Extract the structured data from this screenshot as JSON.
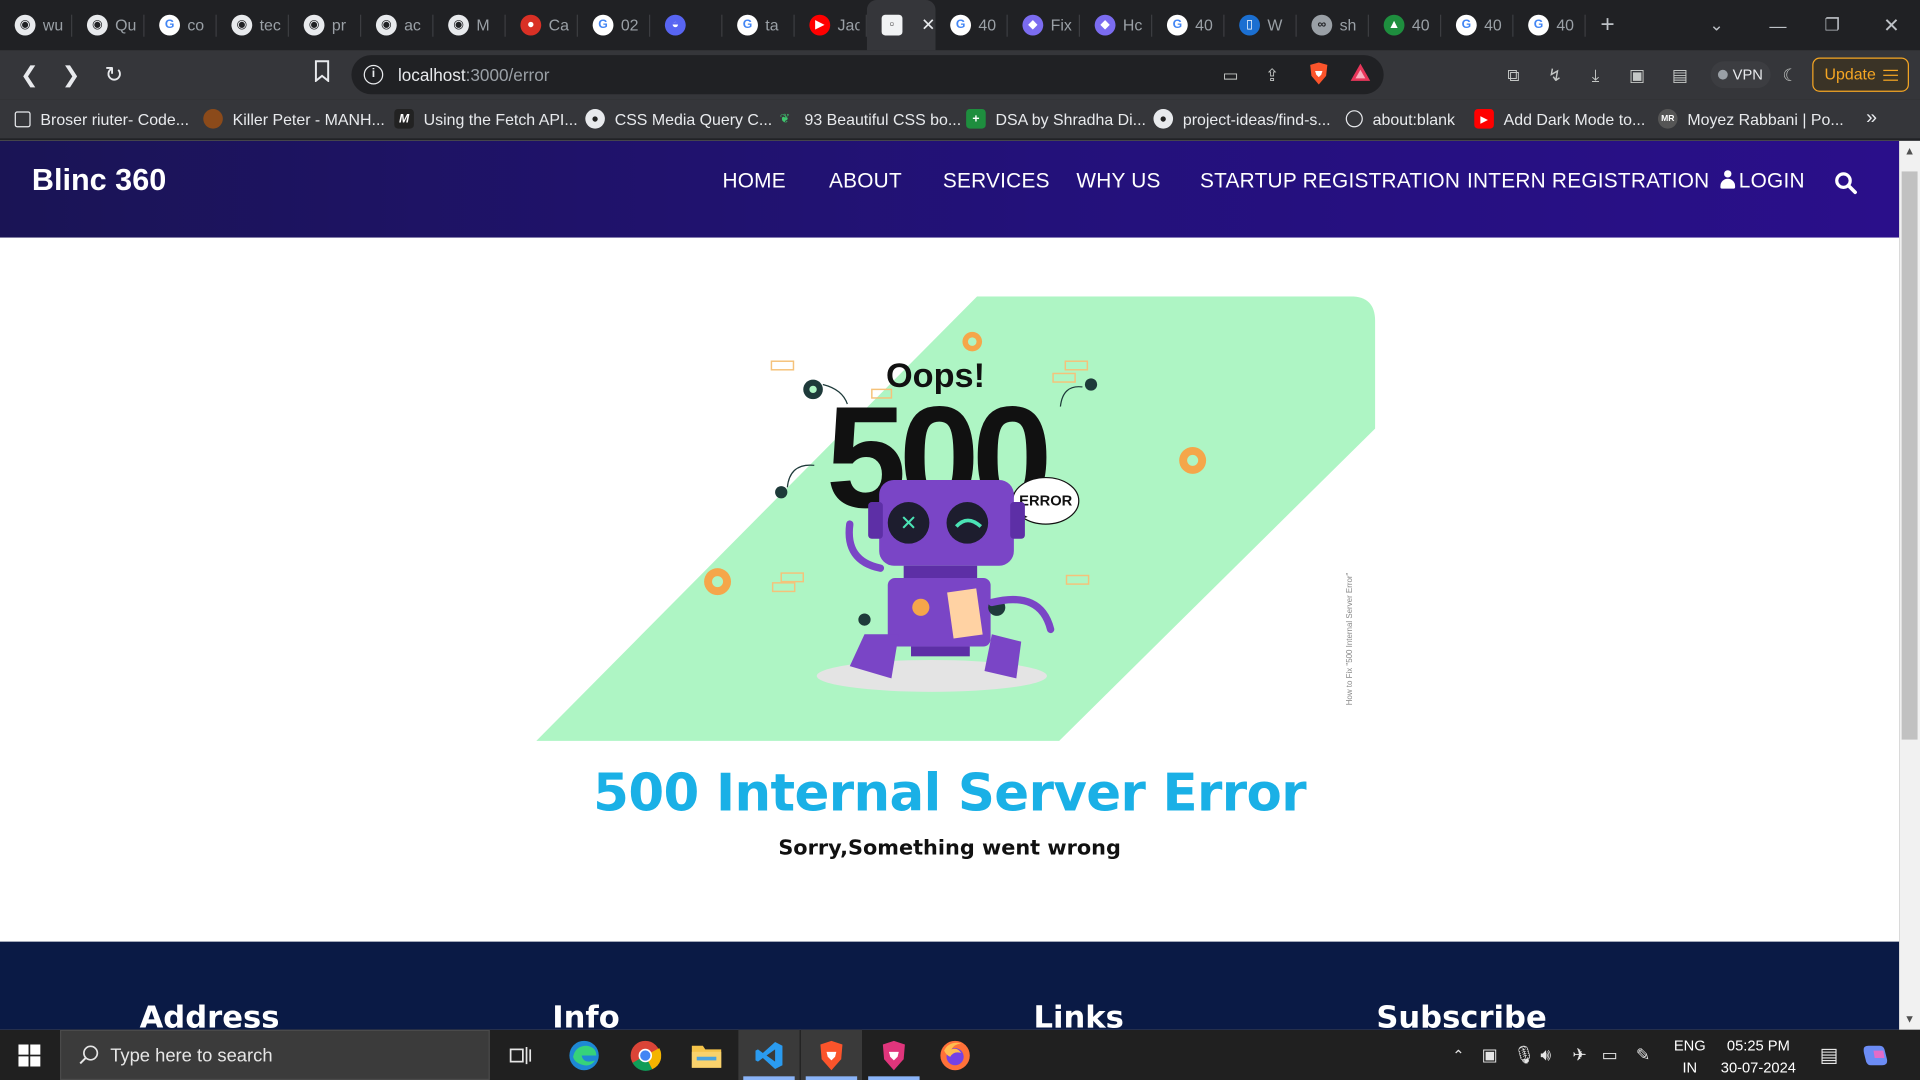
{
  "browser": {
    "tabs": [
      {
        "title": "wu",
        "icon": "github-icon"
      },
      {
        "title": "Qu",
        "icon": "github-icon"
      },
      {
        "title": "co",
        "icon": "google-icon"
      },
      {
        "title": "tec",
        "icon": "github-icon"
      },
      {
        "title": "pr",
        "icon": "github-icon"
      },
      {
        "title": "ac",
        "icon": "github-icon"
      },
      {
        "title": "M",
        "icon": "github-icon"
      },
      {
        "title": "Ca",
        "icon": "record-icon"
      },
      {
        "title": "02",
        "icon": "google-icon"
      },
      {
        "title": "",
        "icon": "discord-icon"
      },
      {
        "title": "ta",
        "icon": "google-icon"
      },
      {
        "title": "Jac",
        "icon": "youtube-icon"
      },
      {
        "title": "",
        "icon": "localhost-icon",
        "active": true
      },
      {
        "title": "40",
        "icon": "google-icon"
      },
      {
        "title": "Fix",
        "icon": "gitlab-icon"
      },
      {
        "title": "Hc",
        "icon": "gitlab-icon"
      },
      {
        "title": "40",
        "icon": "google-icon"
      },
      {
        "title": "W",
        "icon": "trello-icon"
      },
      {
        "title": "sh",
        "icon": "link-icon"
      },
      {
        "title": "40",
        "icon": "drive-icon"
      },
      {
        "title": "40",
        "icon": "google-icon"
      },
      {
        "title": "40",
        "icon": "google-icon"
      }
    ],
    "url_host": "localhost",
    "url_path": ":3000/error",
    "vpn_label": "VPN",
    "update_label": "Update",
    "bookmarks": [
      "Broser riuter- Code...",
      "Killer Peter - MANH...",
      "Using the Fetch API...",
      "CSS Media Query C...",
      "93 Beautiful CSS bo...",
      "DSA by Shradha Di...",
      "project-ideas/find-s...",
      "about:blank",
      "Add Dark Mode to...",
      "Moyez Rabbani | Po..."
    ],
    "bookmarks_more": "»"
  },
  "site": {
    "brand": "Blinc 360",
    "nav": [
      "HOME",
      "ABOUT",
      "SERVICES",
      "WHY US",
      "STARTUP REGISTRATION",
      "INTERN REGISTRATION"
    ],
    "login_label": "LOGIN",
    "illustration": {
      "oops": "Oops!",
      "code": "500",
      "bubble": "ERROR",
      "caption": "How to Fix \"500 Internal Server Error\""
    },
    "error_title": "500 Internal Server Error",
    "error_subtitle": "Sorry,Something went wrong",
    "footer_columns": [
      "Address",
      "Info",
      "Links",
      "Subscribe"
    ],
    "colors": {
      "nav_bg": "#23117a",
      "title": "#1ab0e6",
      "footer_bg": "#0a1a45",
      "illustration_bg": "#aef5c4",
      "robot": "#7a45c6"
    }
  },
  "taskbar": {
    "search_placeholder": "Type here to search",
    "apps": [
      "task-view-icon",
      "edge-icon",
      "chrome-icon",
      "file-explorer-icon",
      "vscode-icon",
      "brave-icon",
      "brave-beta-icon",
      "firefox-icon"
    ],
    "lang_top": "ENG",
    "lang_bottom": "IN",
    "time": "05:25 PM",
    "date": "30-07-2024"
  }
}
